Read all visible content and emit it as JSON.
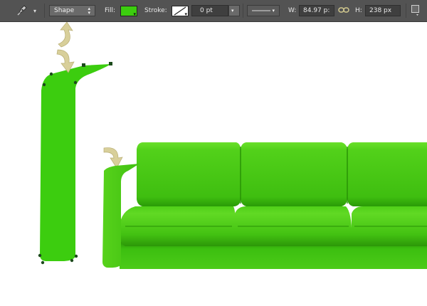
{
  "toolbar": {
    "tool_icon": "pen-tool-icon",
    "mode_label": "Shape",
    "fill_label": "Fill:",
    "fill_color": "#3ccd0f",
    "stroke_label": "Stroke:",
    "stroke_width": "0 pt",
    "width_label": "W:",
    "width_value": "84.97 p:",
    "link_icon": "chain-link-icon",
    "height_label": "H:",
    "height_value": "238 px",
    "align_icon": "path-align-icon"
  },
  "colors": {
    "shape_fill": "#3ccd0f",
    "sofa_light": "#5ad41c",
    "sofa_dark": "#2a9606",
    "arrow": "#d8cf9a"
  }
}
